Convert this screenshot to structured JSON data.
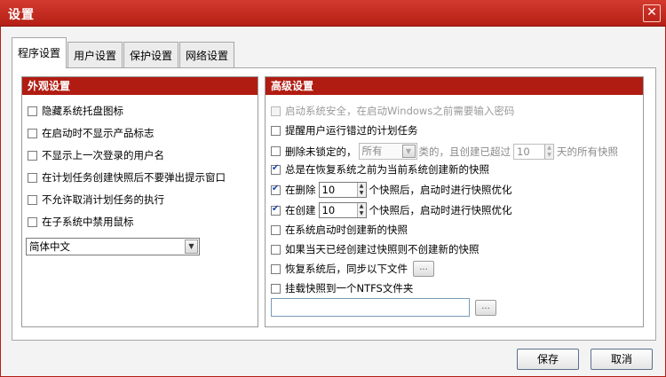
{
  "window": {
    "title": "设置",
    "close_glyph": "✕"
  },
  "tabs": [
    {
      "label": "程序设置",
      "active": true
    },
    {
      "label": "用户设置",
      "active": false
    },
    {
      "label": "保护设置",
      "active": false
    },
    {
      "label": "网络设置",
      "active": false
    }
  ],
  "appearance": {
    "header": "外观设置",
    "options": [
      {
        "label": "隐藏系统托盘图标",
        "checked": false
      },
      {
        "label": "在启动时不显示产品标志",
        "checked": false
      },
      {
        "label": "不显示上一次登录的用户名",
        "checked": false
      },
      {
        "label": "在计划任务创建快照后不要弹出提示窗口",
        "checked": false
      },
      {
        "label": "不允许取消计划任务的执行",
        "checked": false
      },
      {
        "label": "在子系统中禁用鼠标",
        "checked": false
      }
    ],
    "language": {
      "selected": "简体中文"
    }
  },
  "advanced": {
    "header": "高级设置",
    "startup_security": {
      "label": "启动系统安全，在启动Windows之前需要输入密码",
      "checked": false,
      "disabled": true
    },
    "remind_missed": {
      "label": "提醒用户运行错过的计划任务",
      "checked": false
    },
    "delete_unlocked": {
      "label_before": "删除未锁定的，",
      "type_selected": "所有",
      "label_mid": "类的，且创建已超过",
      "days_value": "10",
      "label_after": "天的所有快照",
      "checked": false
    },
    "always_create_before_restore": {
      "label": "总是在恢复系统之前为当前系统创建新的快照",
      "checked": true
    },
    "optimize_on_delete": {
      "label_before": "在删除",
      "value": "10",
      "label_after": "个快照后，启动时进行快照优化",
      "checked": true
    },
    "optimize_on_create": {
      "label_before": "在创建",
      "value": "10",
      "label_after": "个快照后，启动时进行快照优化",
      "checked": true
    },
    "create_on_boot": {
      "label": "在系统启动时创建新的快照",
      "checked": false
    },
    "skip_if_exists_today": {
      "label": "如果当天已经创建过快照则不创建新的快照",
      "checked": false
    },
    "sync_after_restore": {
      "label": "恢复系统后，同步以下文件",
      "checked": false,
      "browse_label": "..."
    },
    "mount_ntfs": {
      "label": "挂载快照到一个NTFS文件夹",
      "checked": false,
      "path_value": "",
      "browse_label": "..."
    }
  },
  "buttons": {
    "save": "保存",
    "cancel": "取消"
  },
  "icons": {
    "spin_up": "▲",
    "spin_down": "▼",
    "dropdown": "▼"
  }
}
